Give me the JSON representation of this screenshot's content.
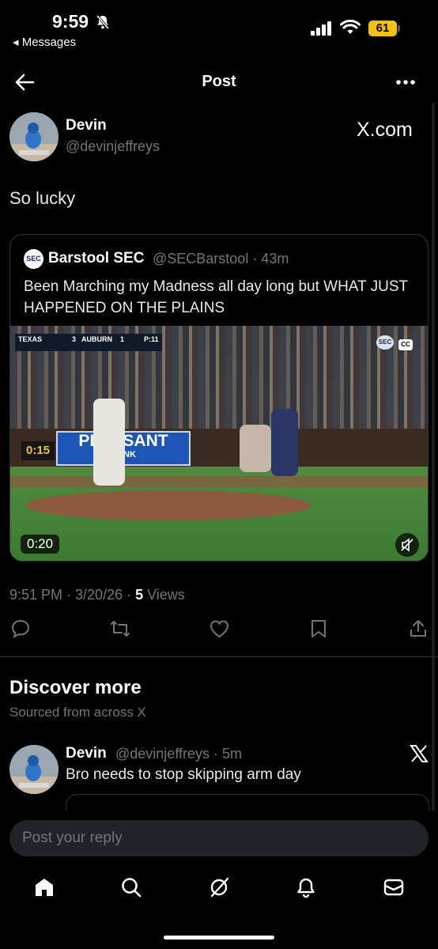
{
  "status_bar": {
    "time": "9:59",
    "back_app": "Messages",
    "battery": "61"
  },
  "header": {
    "title": "Post"
  },
  "post": {
    "author_name": "Devin",
    "author_handle": "@devinjeffreys",
    "source_logo": "X.com",
    "text": "So lucky",
    "timestamp": "9:51 PM · 3/20/26 · ",
    "views_count": "5",
    "views_label": " Views"
  },
  "quote": {
    "author_name": "Barstool SEC",
    "author_handle": "@SECBarstool · 43m",
    "avatar_label": "SEC",
    "text": "Been Marching my Madness all day long but WHAT JUST HAPPENED ON THE PLAINS",
    "video": {
      "duration": "0:20",
      "shot_clock": "0:15",
      "banner_text": "PLEASANT",
      "banner_sub": "BANK",
      "scorebug": {
        "team1": "TEXAS",
        "score1": "3",
        "team2": "AUBURN",
        "score2": "1",
        "inning": "P:11"
      },
      "cc": "CC",
      "sec_bug": "SEC"
    }
  },
  "discover": {
    "title": "Discover more",
    "subtitle": "Sourced from across X"
  },
  "related": {
    "author_name": "Devin",
    "author_handle": "@devinjeffreys · 5m",
    "text": "Bro needs to stop skipping arm day"
  },
  "reply": {
    "placeholder": "Post your reply"
  },
  "icons": [
    "bell-slash-icon",
    "signal-icon",
    "wifi-icon",
    "back-arrow-icon",
    "more-icon",
    "reply-icon",
    "repost-icon",
    "like-icon",
    "bookmark-icon",
    "share-icon",
    "home-icon",
    "search-icon",
    "grok-icon",
    "notifications-icon",
    "messages-icon",
    "mute-icon",
    "x-logo-icon"
  ]
}
